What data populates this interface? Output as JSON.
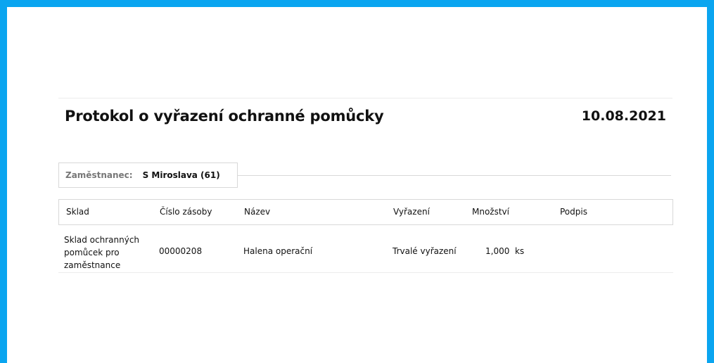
{
  "document": {
    "title": "Protokol o vyřazení ochranné pomůcky",
    "date": "10.08.2021"
  },
  "employee": {
    "label": "Zaměstnanec:",
    "value": "S Miroslava (61)"
  },
  "table": {
    "headers": [
      "Sklad",
      "Číslo zásoby",
      "Název",
      "Vyřazení",
      "Množství",
      "Podpis"
    ],
    "rows": [
      {
        "sklad_lines": [
          "Sklad ochranných",
          "pomůcek pro",
          "zaměstnance"
        ],
        "cislo_zasoby": "00000208",
        "nazev": "Halena operační",
        "vyrazeni": "Trvalé vyřazení",
        "mnozstvi": "1,000  ks",
        "podpis": ""
      }
    ]
  },
  "colors": {
    "frame": "#0aa5f0",
    "background": "#ffffff",
    "border": "#d8d8d8"
  }
}
